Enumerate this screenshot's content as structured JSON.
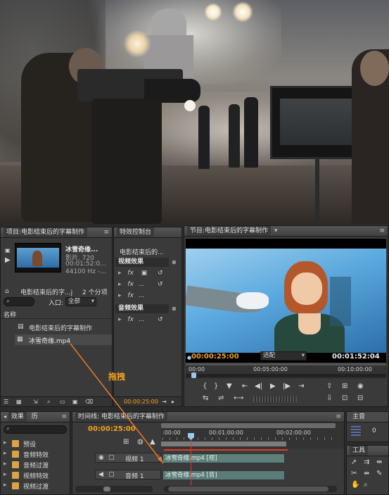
{
  "annotation": {
    "drag_label": "拖拽"
  },
  "project": {
    "title": "项目:电影结束后的字幕制作",
    "clip_name": "冰雪奇缘...",
    "clip_info": [
      "影片, 720",
      "00:01:52:0...",
      "44100 Hz -..."
    ],
    "bin_name": "电影结束后的字...j",
    "item_count": "2 个分项",
    "entry_label": "入口:",
    "entry_value": "全部",
    "column_header": "名称",
    "items": [
      {
        "label": "电影结束后的字幕制作",
        "icon": "sequence-icon"
      },
      {
        "label": "冰雪奇缘.mp4",
        "icon": "video-file-icon"
      }
    ]
  },
  "effect_controls": {
    "title": "特效控制台",
    "subtitle": "电影结束后的...",
    "video_section": "视频效果",
    "audio_section": "音频效果",
    "fx_label": "fx",
    "fx_items": [
      "",
      "...",
      "...",
      "..."
    ],
    "audio_fx": [
      "..."
    ],
    "timecode": "00:00:25:00"
  },
  "program": {
    "title": "节目:电影结束后的字幕制作",
    "current_time": "00:00:25:00",
    "fit_value": "适配",
    "duration": "00:01:52:04",
    "ruler": [
      "00:00",
      "00:05:00:00",
      "00:10:00:00"
    ]
  },
  "effects": {
    "tabs": [
      "效果",
      "历"
    ],
    "items": [
      "预设",
      "音频特效",
      "音频过渡",
      "视频特效",
      "视频过渡"
    ]
  },
  "timeline": {
    "title": "时间线: 电影结束后的字幕制作",
    "timecode": "00:00:25:00",
    "ruler": [
      ":00:00",
      "00:01:00:00",
      "00:02:00:00"
    ],
    "tracks": [
      {
        "name": "视频 1",
        "clip": "冰雪奇缘.mp4 [视]"
      },
      {
        "name": "音频 1",
        "clip": "冰雪奇缘.mp4 [音]"
      }
    ]
  },
  "audio_master": {
    "title": "主音",
    "value": "0"
  },
  "tools": {
    "title": "工具"
  },
  "colors": {
    "accent_orange": "#f2a21c",
    "drag_arrow": "#e67a2e",
    "playhead_red": "#e03a2a",
    "clip_teal": "#5f7f7a"
  }
}
